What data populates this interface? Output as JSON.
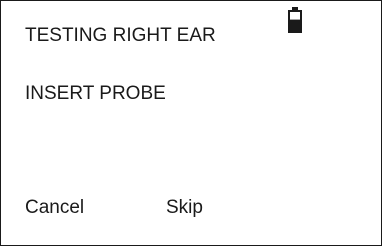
{
  "display": {
    "line1": "TESTING RIGHT EAR",
    "line2": "INSERT PROBE",
    "battery_icon": "battery-icon",
    "battery_level": 0.6
  },
  "softkeys": {
    "left_label": "Cancel",
    "right_label": "Skip"
  },
  "colors": {
    "text": "#1a1a1a",
    "background": "#ffffff"
  }
}
